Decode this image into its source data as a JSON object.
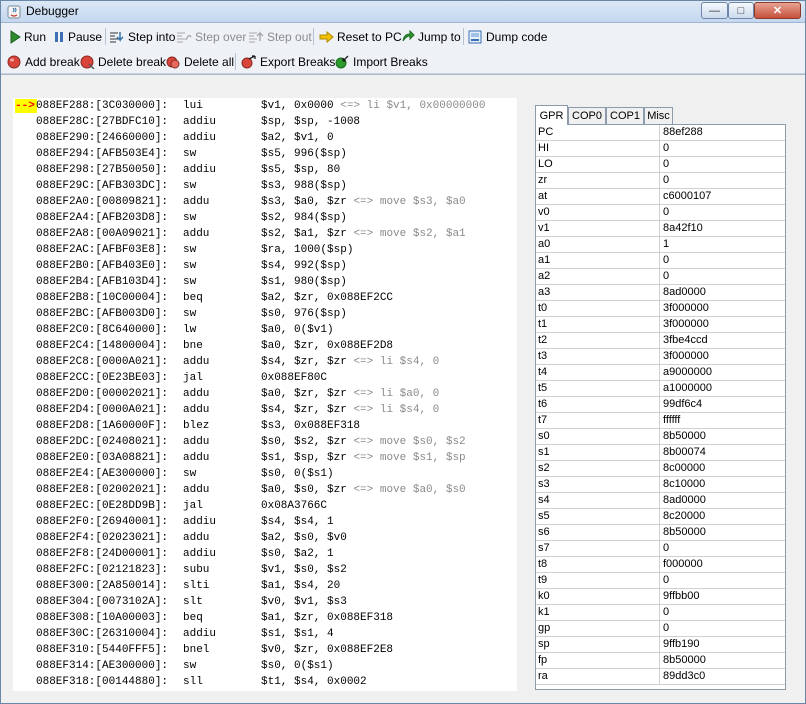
{
  "window": {
    "title": "Debugger"
  },
  "toolbar": {
    "run": "Run",
    "pause": "Pause",
    "step_into": "Step into",
    "step_over": "Step over",
    "step_out": "Step out",
    "reset_to_pc": "Reset to PC",
    "jump_to": "Jump to",
    "dump_code": "Dump code",
    "add_break": "Add break",
    "delete_break": "Delete break",
    "delete_all": "Delete all",
    "export_breaks": "Export Breaks",
    "import_breaks": "Import Breaks"
  },
  "disasm": {
    "pc_marker": "-->",
    "lines": [
      {
        "addr": "088EF288:[3C030000]:",
        "mnemonic": "lui",
        "operands": "$v1, 0x0000",
        "comment": "<=> li $v1, 0x00000000"
      },
      {
        "addr": "088EF28C:[27BDFC10]:",
        "mnemonic": "addiu",
        "operands": "$sp, $sp, -1008",
        "comment": ""
      },
      {
        "addr": "088EF290:[24660000]:",
        "mnemonic": "addiu",
        "operands": "$a2, $v1, 0",
        "comment": ""
      },
      {
        "addr": "088EF294:[AFB503E4]:",
        "mnemonic": "sw",
        "operands": "$s5, 996($sp)",
        "comment": ""
      },
      {
        "addr": "088EF298:[27B50050]:",
        "mnemonic": "addiu",
        "operands": "$s5, $sp, 80",
        "comment": ""
      },
      {
        "addr": "088EF29C:[AFB303DC]:",
        "mnemonic": "sw",
        "operands": "$s3, 988($sp)",
        "comment": ""
      },
      {
        "addr": "088EF2A0:[00809821]:",
        "mnemonic": "addu",
        "operands": "$s3, $a0, $zr",
        "comment": "<=> move $s3, $a0"
      },
      {
        "addr": "088EF2A4:[AFB203D8]:",
        "mnemonic": "sw",
        "operands": "$s2, 984($sp)",
        "comment": ""
      },
      {
        "addr": "088EF2A8:[00A09021]:",
        "mnemonic": "addu",
        "operands": "$s2, $a1, $zr",
        "comment": "<=> move $s2, $a1"
      },
      {
        "addr": "088EF2AC:[AFBF03E8]:",
        "mnemonic": "sw",
        "operands": "$ra, 1000($sp)",
        "comment": ""
      },
      {
        "addr": "088EF2B0:[AFB403E0]:",
        "mnemonic": "sw",
        "operands": "$s4, 992($sp)",
        "comment": ""
      },
      {
        "addr": "088EF2B4:[AFB103D4]:",
        "mnemonic": "sw",
        "operands": "$s1, 980($sp)",
        "comment": ""
      },
      {
        "addr": "088EF2B8:[10C00004]:",
        "mnemonic": "beq",
        "operands": "$a2, $zr, 0x088EF2CC",
        "comment": ""
      },
      {
        "addr": "088EF2BC:[AFB003D0]:",
        "mnemonic": "sw",
        "operands": "$s0, 976($sp)",
        "comment": ""
      },
      {
        "addr": "088EF2C0:[8C640000]:",
        "mnemonic": "lw",
        "operands": "$a0, 0($v1)",
        "comment": ""
      },
      {
        "addr": "088EF2C4:[14800004]:",
        "mnemonic": "bne",
        "operands": "$a0, $zr, 0x088EF2D8",
        "comment": ""
      },
      {
        "addr": "088EF2C8:[0000A021]:",
        "mnemonic": "addu",
        "operands": "$s4, $zr, $zr",
        "comment": "<=> li $s4, 0"
      },
      {
        "addr": "088EF2CC:[0E23BE03]:",
        "mnemonic": "jal",
        "operands": "0x088EF80C",
        "comment": ""
      },
      {
        "addr": "088EF2D0:[00002021]:",
        "mnemonic": "addu",
        "operands": "$a0, $zr, $zr",
        "comment": "<=> li $a0, 0"
      },
      {
        "addr": "088EF2D4:[0000A021]:",
        "mnemonic": "addu",
        "operands": "$s4, $zr, $zr",
        "comment": "<=> li $s4, 0"
      },
      {
        "addr": "088EF2D8:[1A60000F]:",
        "mnemonic": "blez",
        "operands": "$s3, 0x088EF318",
        "comment": ""
      },
      {
        "addr": "088EF2DC:[02408021]:",
        "mnemonic": "addu",
        "operands": "$s0, $s2, $zr",
        "comment": "<=> move $s0, $s2"
      },
      {
        "addr": "088EF2E0:[03A08821]:",
        "mnemonic": "addu",
        "operands": "$s1, $sp, $zr",
        "comment": "<=> move $s1, $sp"
      },
      {
        "addr": "088EF2E4:[AE300000]:",
        "mnemonic": "sw",
        "operands": "$s0, 0($s1)",
        "comment": ""
      },
      {
        "addr": "088EF2E8:[02002021]:",
        "mnemonic": "addu",
        "operands": "$a0, $s0, $zr",
        "comment": "<=> move $a0, $s0"
      },
      {
        "addr": "088EF2EC:[0E28DD9B]:",
        "mnemonic": "jal",
        "operands": "0x08A3766C",
        "comment": ""
      },
      {
        "addr": "088EF2F0:[26940001]:",
        "mnemonic": "addiu",
        "operands": "$s4, $s4, 1",
        "comment": ""
      },
      {
        "addr": "088EF2F4:[02023021]:",
        "mnemonic": "addu",
        "operands": "$a2, $s0, $v0",
        "comment": ""
      },
      {
        "addr": "088EF2F8:[24D00001]:",
        "mnemonic": "addiu",
        "operands": "$s0, $a2, 1",
        "comment": ""
      },
      {
        "addr": "088EF2FC:[02121823]:",
        "mnemonic": "subu",
        "operands": "$v1, $s0, $s2",
        "comment": ""
      },
      {
        "addr": "088EF300:[2A850014]:",
        "mnemonic": "slti",
        "operands": "$a1, $s4, 20",
        "comment": ""
      },
      {
        "addr": "088EF304:[0073102A]:",
        "mnemonic": "slt",
        "operands": "$v0, $v1, $s3",
        "comment": ""
      },
      {
        "addr": "088EF308:[10A00003]:",
        "mnemonic": "beq",
        "operands": "$a1, $zr, 0x088EF318",
        "comment": ""
      },
      {
        "addr": "088EF30C:[26310004]:",
        "mnemonic": "addiu",
        "operands": "$s1, $s1, 4",
        "comment": ""
      },
      {
        "addr": "088EF310:[5440FFF5]:",
        "mnemonic": "bnel",
        "operands": "$v0, $zr, 0x088EF2E8",
        "comment": ""
      },
      {
        "addr": "088EF314:[AE300000]:",
        "mnemonic": "sw",
        "operands": "$s0, 0($s1)",
        "comment": ""
      },
      {
        "addr": "088EF318:[00144880]:",
        "mnemonic": "sll",
        "operands": "$t1, $s4, 0x0002",
        "comment": ""
      }
    ]
  },
  "register_tabs": [
    {
      "label": "GPR",
      "active": true
    },
    {
      "label": "COP0",
      "active": false
    },
    {
      "label": "COP1",
      "active": false
    },
    {
      "label": "Misc",
      "active": false
    }
  ],
  "registers": [
    {
      "name": "PC",
      "value": "88ef288"
    },
    {
      "name": "HI",
      "value": "0"
    },
    {
      "name": "LO",
      "value": "0"
    },
    {
      "name": "zr",
      "value": "0"
    },
    {
      "name": "at",
      "value": "c6000107"
    },
    {
      "name": "v0",
      "value": "0"
    },
    {
      "name": "v1",
      "value": "8a42f10"
    },
    {
      "name": "a0",
      "value": "1"
    },
    {
      "name": "a1",
      "value": "0"
    },
    {
      "name": "a2",
      "value": "0"
    },
    {
      "name": "a3",
      "value": "8ad0000"
    },
    {
      "name": "t0",
      "value": "3f000000"
    },
    {
      "name": "t1",
      "value": "3f000000"
    },
    {
      "name": "t2",
      "value": "3fbe4ccd"
    },
    {
      "name": "t3",
      "value": "3f000000"
    },
    {
      "name": "t4",
      "value": "a9000000"
    },
    {
      "name": "t5",
      "value": "a1000000"
    },
    {
      "name": "t6",
      "value": "99df6c4"
    },
    {
      "name": "t7",
      "value": "ffffff"
    },
    {
      "name": "s0",
      "value": "8b50000"
    },
    {
      "name": "s1",
      "value": "8b00074"
    },
    {
      "name": "s2",
      "value": "8c00000"
    },
    {
      "name": "s3",
      "value": "8c10000"
    },
    {
      "name": "s4",
      "value": "8ad0000"
    },
    {
      "name": "s5",
      "value": "8c20000"
    },
    {
      "name": "s6",
      "value": "8b50000"
    },
    {
      "name": "s7",
      "value": "0"
    },
    {
      "name": "t8",
      "value": "f000000"
    },
    {
      "name": "t9",
      "value": "0"
    },
    {
      "name": "k0",
      "value": "9ffbb00"
    },
    {
      "name": "k1",
      "value": "0"
    },
    {
      "name": "gp",
      "value": "0"
    },
    {
      "name": "sp",
      "value": "9ffb190"
    },
    {
      "name": "fp",
      "value": "8b50000"
    },
    {
      "name": "ra",
      "value": "89dd3c0"
    }
  ],
  "colors": {
    "pc_highlight": "#ffff00",
    "pc_arrow": "#ff0000",
    "comment_text": "#8a8a8a",
    "disabled_text": "#8c8c8c"
  },
  "icons": {
    "run": "play-icon",
    "pause": "pause-icon",
    "step_into": "step-into-icon",
    "step_over": "step-over-icon",
    "step_out": "step-out-icon",
    "reset_to_pc": "arrow-right-icon",
    "jump_to": "jump-arrow-icon",
    "dump_code": "dump-icon",
    "add_break": "breakpoint-add-icon",
    "delete_break": "breakpoint-delete-icon",
    "delete_all": "breakpoint-delete-all-icon",
    "export_breaks": "export-icon",
    "import_breaks": "import-icon"
  }
}
